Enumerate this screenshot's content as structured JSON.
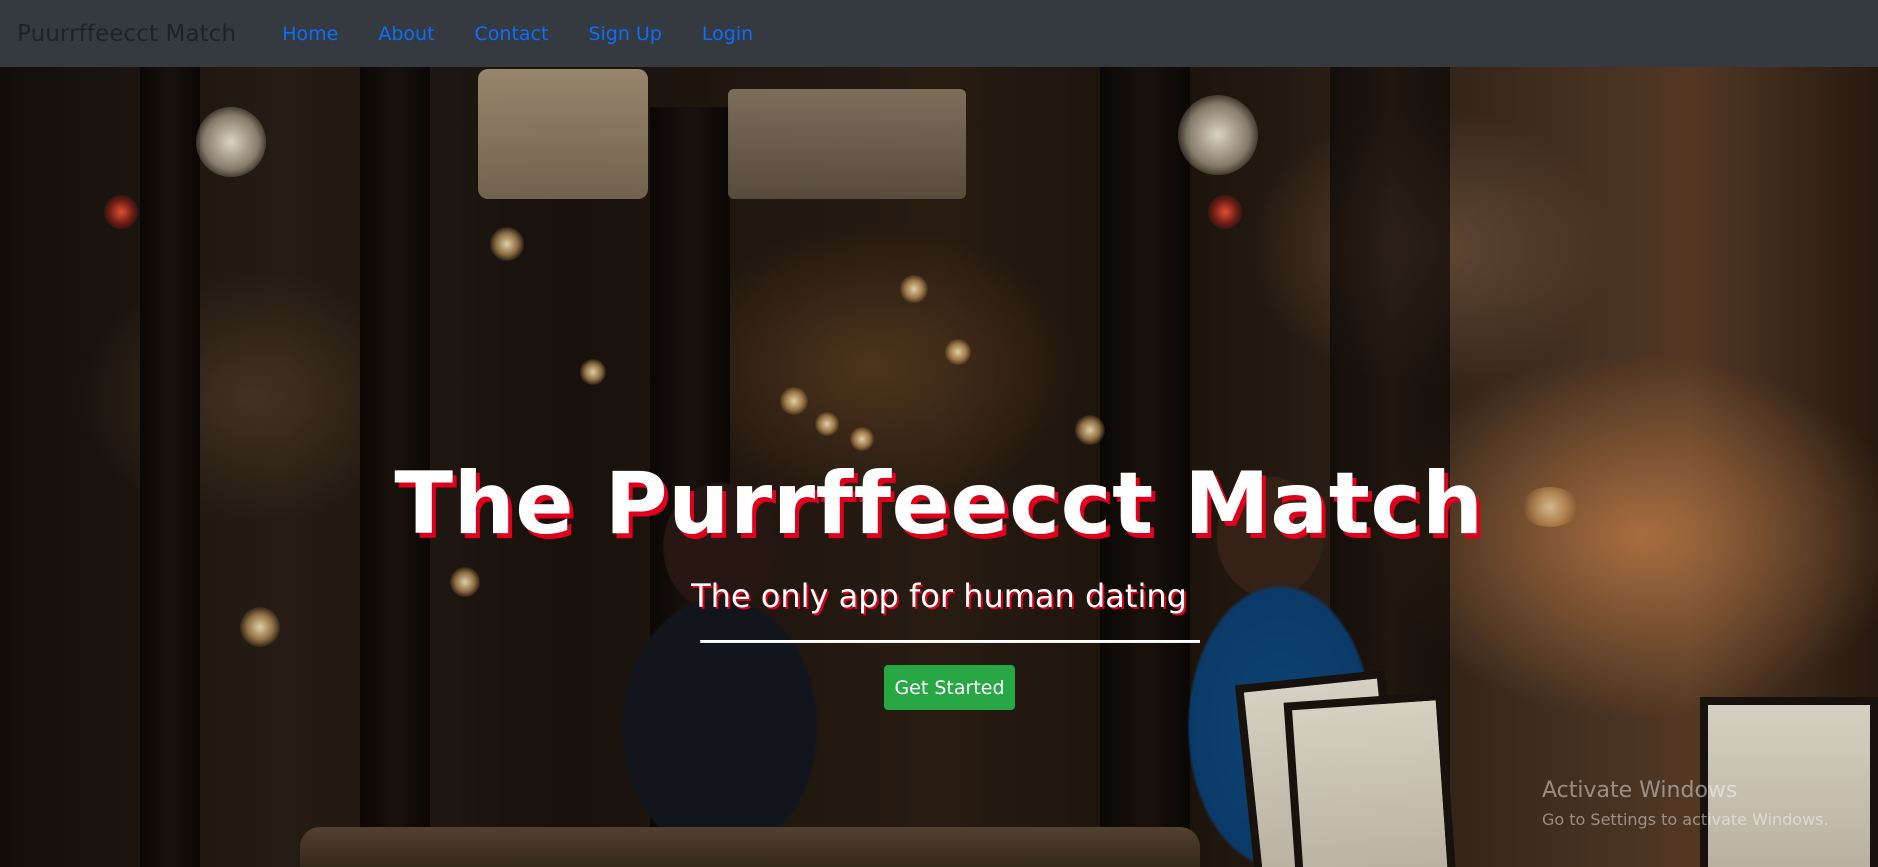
{
  "navbar": {
    "brand": "Puurrffeecct Match",
    "links": [
      {
        "label": "Home"
      },
      {
        "label": "About"
      },
      {
        "label": "Contact"
      },
      {
        "label": "Sign Up"
      },
      {
        "label": "Login"
      }
    ]
  },
  "hero": {
    "title": "The Purrffeecct Match",
    "subtitle": "The only app for human dating",
    "cta_label": "Get Started",
    "background": "photo-couple-at-night-cafe"
  },
  "watermark": {
    "title": "Activate Windows",
    "subtitle": "Go to Settings to activate Windows."
  },
  "colors": {
    "navbar_bg": "#343a40",
    "link": "#0d6efd",
    "title_shadow": "#e0001b",
    "cta_bg": "#28a745"
  }
}
